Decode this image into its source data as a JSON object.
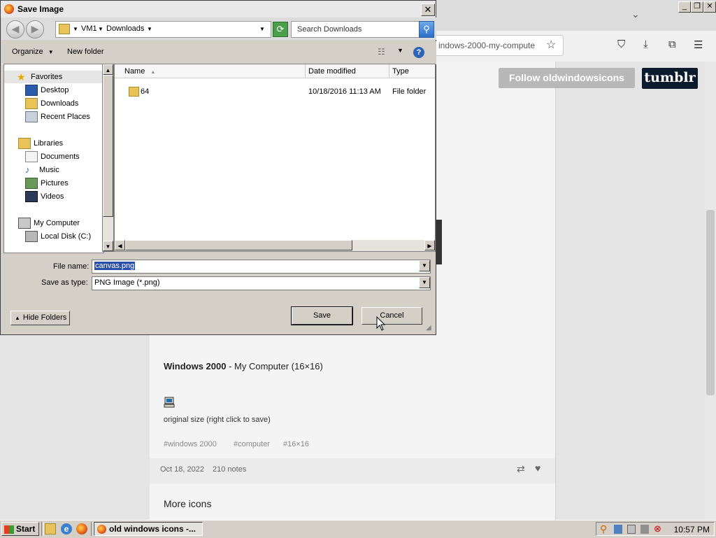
{
  "browser": {
    "url_text": "indows-2000-my-compute",
    "follow_label": "Follow oldwindowsicons",
    "tumblr_label": "tumblr"
  },
  "post": {
    "title_bold": "Windows 2000",
    "title_rest": " - My Computer (16×16)",
    "caption": "original size (right click to save)",
    "tags": [
      "#windows 2000",
      "#computer",
      "#16×16"
    ],
    "date": "Oct 18, 2022",
    "notes": "210 notes",
    "more_heading": "More icons"
  },
  "dialog": {
    "title": "Save Image",
    "address": {
      "crumbs": [
        "VM1",
        "Downloads"
      ]
    },
    "search_placeholder": "Search Downloads",
    "toolbar": {
      "organize": "Organize",
      "new_folder": "New folder"
    },
    "nav": {
      "favorites": "Favorites",
      "favorites_items": [
        "Desktop",
        "Downloads",
        "Recent Places"
      ],
      "libraries": "Libraries",
      "libraries_items": [
        "Documents",
        "Music",
        "Pictures",
        "Videos"
      ],
      "computer": "My Computer",
      "computer_items": [
        "Local Disk (C:)"
      ]
    },
    "columns": {
      "name": "Name",
      "date": "Date modified",
      "type": "Type"
    },
    "files": [
      {
        "name": "64",
        "date": "10/18/2016 11:13 AM",
        "type": "File folder"
      }
    ],
    "file_name_label": "File name:",
    "file_name_value": "canvas.png",
    "save_type_label": "Save as type:",
    "save_type_value": "PNG Image (*.png)",
    "hide_folders": "Hide Folders",
    "save": "Save",
    "cancel": "Cancel"
  },
  "taskbar": {
    "start": "Start",
    "task": "old windows icons -...",
    "clock": "10:57 PM"
  },
  "colors": {
    "selection": "#2a4fa8",
    "tumblr": "#0b1a2c",
    "follow": "#b8b8b8"
  }
}
